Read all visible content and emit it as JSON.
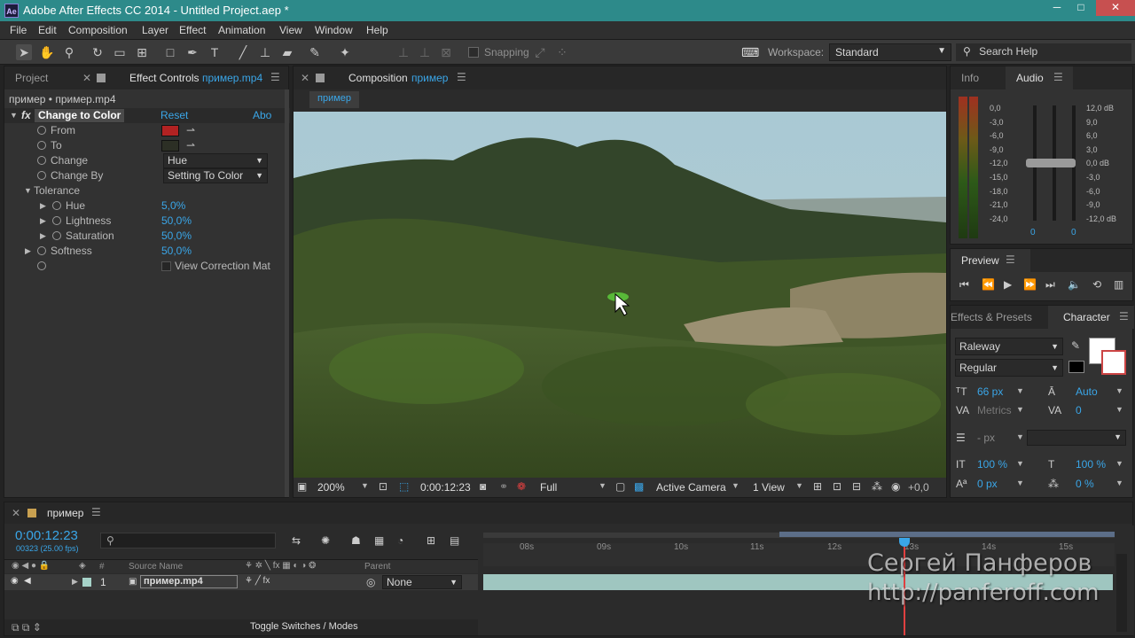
{
  "titlebar": {
    "app_icon": "Ae",
    "title": "Adobe After Effects CC 2014 - Untitled Project.aep *",
    "minimize": "─",
    "maximize": "□",
    "close": "✕"
  },
  "menu": [
    "File",
    "Edit",
    "Composition",
    "Layer",
    "Effect",
    "Animation",
    "View",
    "Window",
    "Help"
  ],
  "toolbar": {
    "snapping_label": "Snapping",
    "workspace_label": "Workspace:",
    "workspace_value": "Standard",
    "search_placeholder": "Search Help"
  },
  "left_panel": {
    "tab_project": "Project",
    "tab_effect_controls": "Effect Controls",
    "tab_effect_file": "пример.mp4",
    "breadcrumb": "пример • пример.mp4",
    "effect": {
      "fx": "fx",
      "name": "Change to Color",
      "reset": "Reset",
      "about": "Abo"
    },
    "props": {
      "from": "From",
      "to": "To",
      "change": "Change",
      "change_value": "Hue",
      "change_by": "Change By",
      "change_by_value": "Setting To Color",
      "tolerance": "Tolerance",
      "hue": "Hue",
      "hue_value": "5,0%",
      "lightness": "Lightness",
      "lightness_value": "50,0%",
      "saturation": "Saturation",
      "saturation_value": "50,0%",
      "softness": "Softness",
      "softness_value": "50,0%",
      "view_correction": "View Correction Mat"
    },
    "colors": {
      "from_swatch": "#b22222",
      "to_swatch": "#2c2f25"
    }
  },
  "comp_panel": {
    "tab_label": "Composition",
    "tab_name": "пример",
    "sub_tab": "пример",
    "footer": {
      "zoom": "200%",
      "timecode": "0:00:12:23",
      "resolution": "Full",
      "camera": "Active Camera",
      "views": "1 View",
      "exposure": "+0,0"
    }
  },
  "right_panel": {
    "tab_info": "Info",
    "tab_audio": "Audio",
    "audio_left_scale": [
      "0,0",
      "-3,0",
      "-6,0",
      "-9,0",
      "-12,0",
      "-15,0",
      "-18,0",
      "-21,0",
      "-24,0"
    ],
    "audio_right_scale": [
      "12,0 dB",
      "9,0",
      "6,0",
      "3,0",
      "0,0 dB",
      "-3,0",
      "-6,0",
      "-9,0",
      "-12,0 dB"
    ],
    "audio_vals": [
      "0",
      "0"
    ],
    "preview_tab": "Preview",
    "tab_effects_presets": "Effects & Presets",
    "tab_character": "Character",
    "character": {
      "font": "Raleway",
      "style": "Regular",
      "size": "66 px",
      "leading": "Auto",
      "kerning": "Metrics",
      "tracking": "0",
      "stroke": "- px",
      "vscale": "100 %",
      "hscale": "100 %",
      "baseline": "0 px",
      "tsume": "0 %"
    }
  },
  "timeline": {
    "tab": "пример",
    "timecode": "0:00:12:23",
    "frames": "00323 (25.00 fps)",
    "col_source": "Source Name",
    "col_parent": "Parent",
    "col_hash": "#",
    "layer": {
      "num": "1",
      "name": "пример.mp4",
      "parent": "None"
    },
    "ruler": [
      "08s",
      "09s",
      "10s",
      "11s",
      "12s",
      "13s",
      "14s",
      "15s"
    ],
    "toggle": "Toggle Switches / Modes"
  },
  "watermark": {
    "name": "Сергей Панферов",
    "url": "http://panferoff.com"
  }
}
